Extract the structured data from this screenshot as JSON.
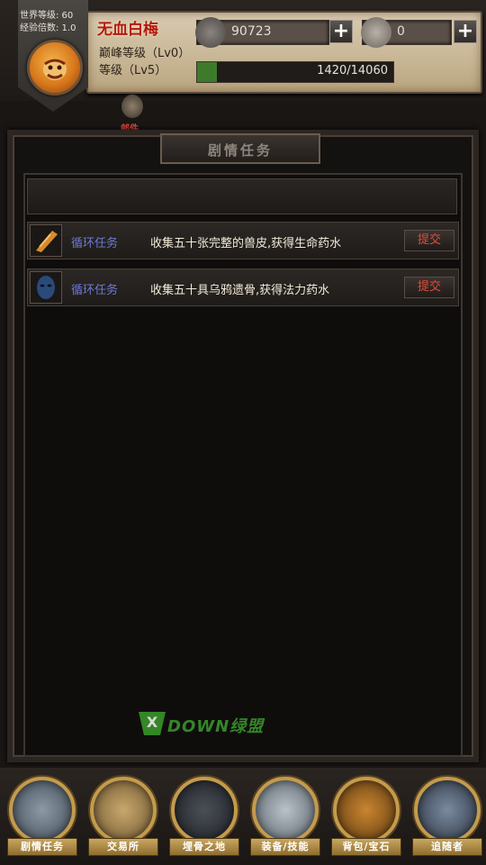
{
  "header": {
    "world_level": "世界等级: 60",
    "exp_multiplier": "经验倍数: 1.0",
    "player_name": "无血白梅",
    "peak_level": "巅峰等级（Lv0）",
    "level": "等级（Lv5）",
    "gold_value": "90723",
    "gem_value": "0",
    "plus_label": "+",
    "exp_text": "1420/14060",
    "exp_fraction": 0.101
  },
  "mail": {
    "label": "邮件"
  },
  "panel": {
    "title": "剧情任务"
  },
  "quests": [
    {
      "type": "循环任务",
      "desc": "收集五十张完整的兽皮,获得生命药水",
      "submit": "提交"
    },
    {
      "type": "循环任务",
      "desc": "收集五十具乌鸦遗骨,获得法力药水",
      "submit": "提交"
    }
  ],
  "watermark": {
    "x": "X",
    "text": "DOWN绿盟"
  },
  "nav": [
    {
      "label": "剧情任务"
    },
    {
      "label": "交易所"
    },
    {
      "label": "埋骨之地"
    },
    {
      "label": "装备/技能"
    },
    {
      "label": "背包/宝石"
    },
    {
      "label": "追随者"
    }
  ],
  "colors": {
    "quest_type": "#6b7bd6",
    "submit": "#e04c3a",
    "name": "#b3190f",
    "nav_gold": "#c39b4c"
  }
}
